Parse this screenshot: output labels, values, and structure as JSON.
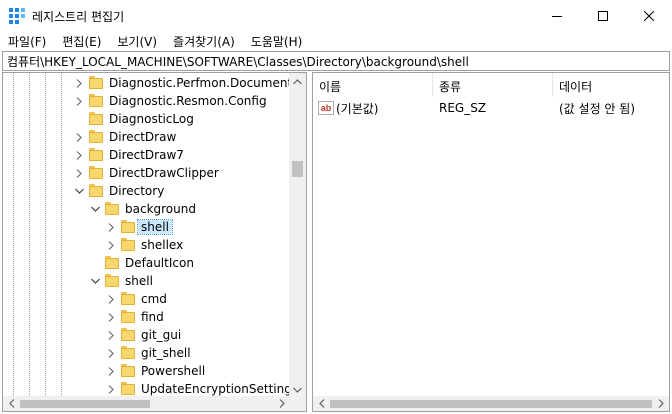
{
  "window": {
    "title": "레지스트리 편집기",
    "app_icon": "registry-editor-icon",
    "controls": [
      "minimize-icon",
      "maximize-icon",
      "close-icon"
    ]
  },
  "menu": [
    {
      "label": "파일(F)"
    },
    {
      "label": "편집(E)"
    },
    {
      "label": "보기(V)"
    },
    {
      "label": "즐겨찾기(A)"
    },
    {
      "label": "도움말(H)"
    }
  ],
  "address": "컴퓨터\\HKEY_LOCAL_MACHINE\\SOFTWARE\\Classes\\Directory\\background\\shell",
  "tree": [
    {
      "label": "Diagnostic.Perfmon.Document",
      "depth": 0,
      "expander": "collapsed",
      "selected": false
    },
    {
      "label": "Diagnostic.Resmon.Config",
      "depth": 0,
      "expander": "collapsed",
      "selected": false
    },
    {
      "label": "DiagnosticLog",
      "depth": 0,
      "expander": "none",
      "selected": false
    },
    {
      "label": "DirectDraw",
      "depth": 0,
      "expander": "collapsed",
      "selected": false
    },
    {
      "label": "DirectDraw7",
      "depth": 0,
      "expander": "collapsed",
      "selected": false
    },
    {
      "label": "DirectDrawClipper",
      "depth": 0,
      "expander": "collapsed",
      "selected": false
    },
    {
      "label": "Directory",
      "depth": 0,
      "expander": "expanded",
      "selected": false
    },
    {
      "label": "background",
      "depth": 1,
      "expander": "expanded",
      "selected": false
    },
    {
      "label": "shell",
      "depth": 2,
      "expander": "collapsed",
      "selected": true
    },
    {
      "label": "shellex",
      "depth": 2,
      "expander": "collapsed",
      "selected": false
    },
    {
      "label": "DefaultIcon",
      "depth": 1,
      "expander": "none",
      "selected": false
    },
    {
      "label": "shell",
      "depth": 1,
      "expander": "expanded",
      "selected": false
    },
    {
      "label": "cmd",
      "depth": 2,
      "expander": "collapsed",
      "selected": false
    },
    {
      "label": "find",
      "depth": 2,
      "expander": "collapsed",
      "selected": false
    },
    {
      "label": "git_gui",
      "depth": 2,
      "expander": "collapsed",
      "selected": false
    },
    {
      "label": "git_shell",
      "depth": 2,
      "expander": "collapsed",
      "selected": false
    },
    {
      "label": "Powershell",
      "depth": 2,
      "expander": "collapsed",
      "selected": false
    },
    {
      "label": "UpdateEncryptionSettings",
      "depth": 2,
      "expander": "collapsed",
      "selected": false
    }
  ],
  "list": {
    "columns": [
      {
        "label": "이름"
      },
      {
        "label": "종류"
      },
      {
        "label": "데이터"
      }
    ],
    "rows": [
      {
        "icon": "ab",
        "name": "(기본값)",
        "type": "REG_SZ",
        "data": "(값 설정 안 됨)"
      }
    ]
  },
  "colors": {
    "selection": "#cce8ff",
    "folder": "#f9d76c",
    "scroll_thumb": "#c1c1c1"
  }
}
